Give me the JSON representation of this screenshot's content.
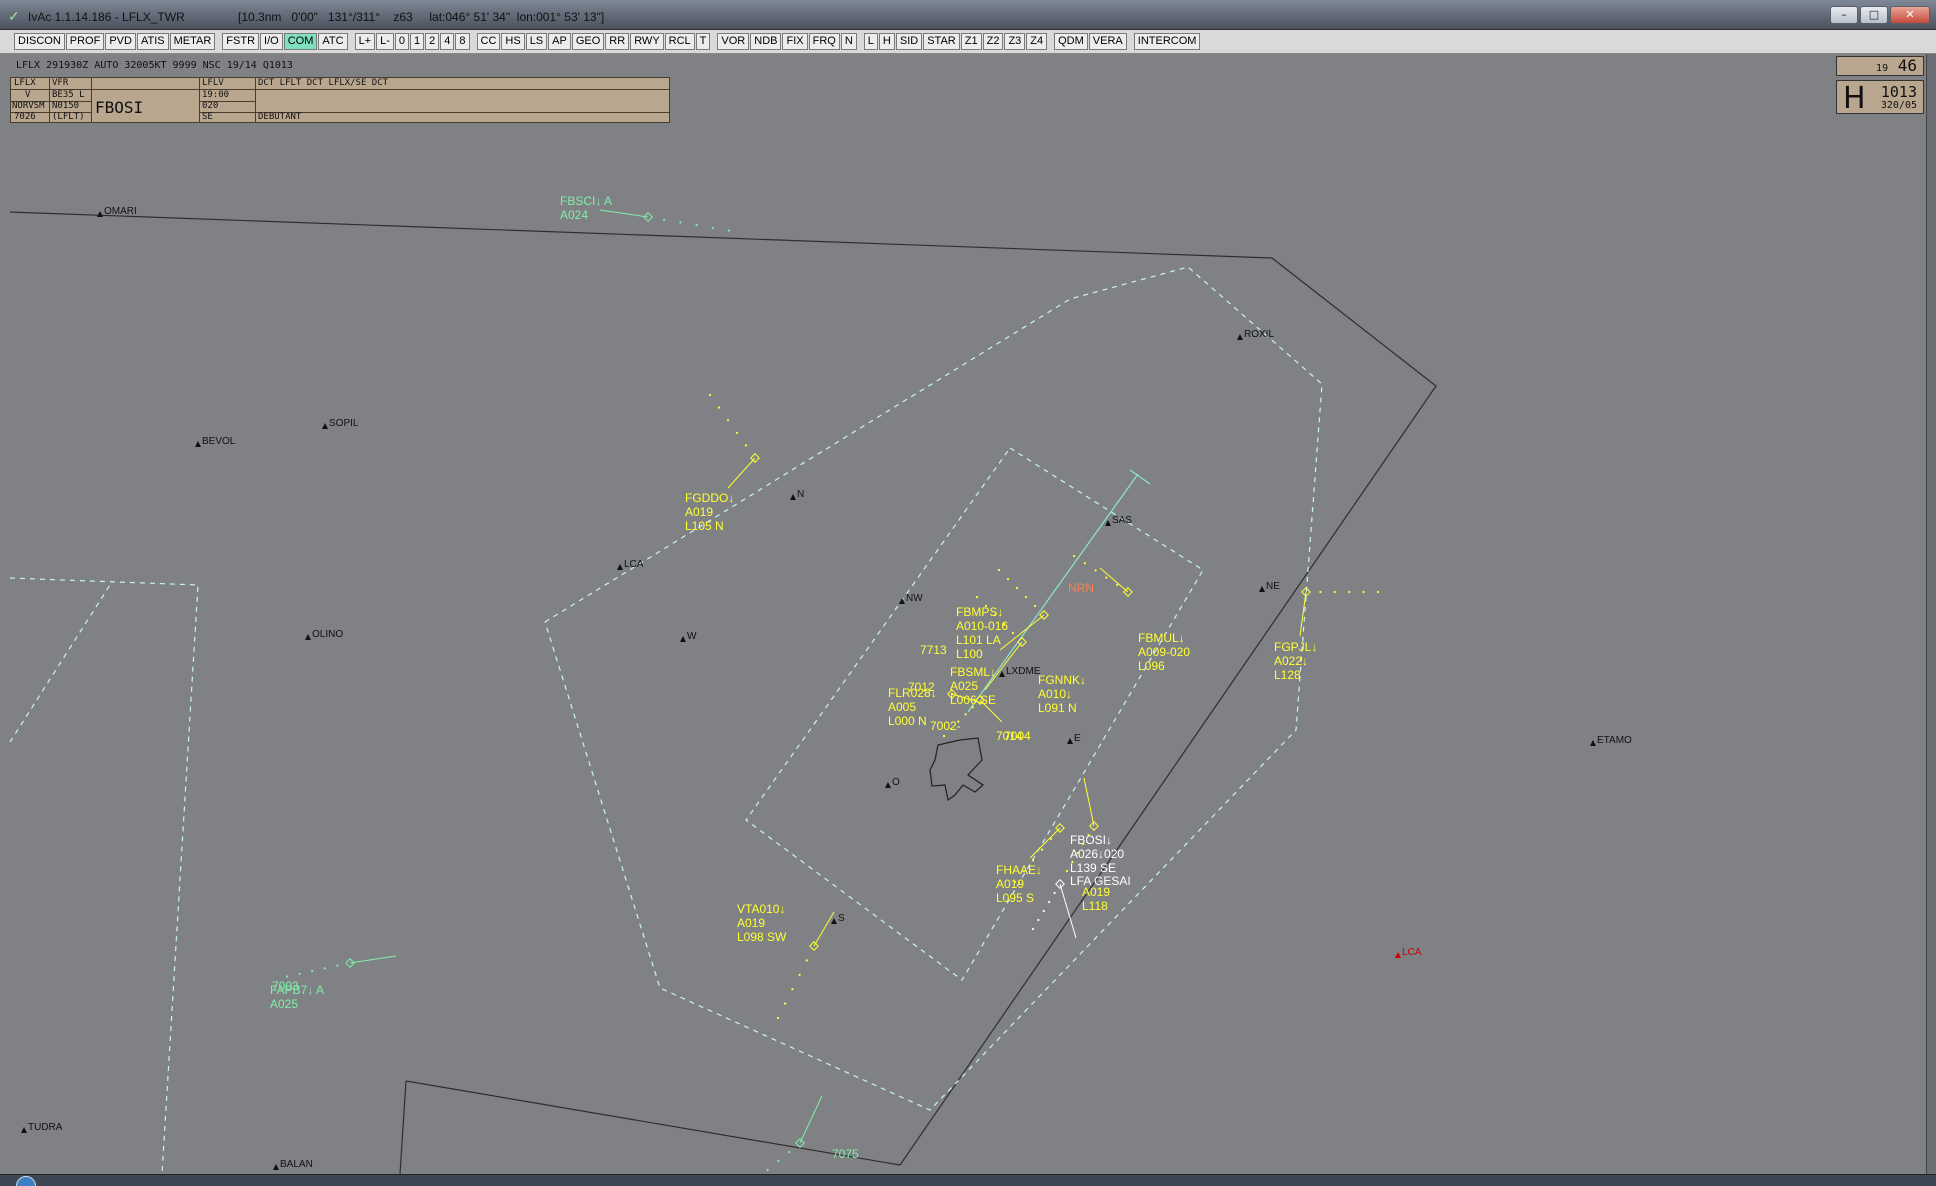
{
  "window": {
    "title": "IvAc 1.1.14.186 - LFLX_TWR",
    "status": "[10.3nm   0'00\"   131°/311°    z63     lat:046° 51' 34\"  lon:001° 53' 13\"]",
    "buttons": {
      "minimize": "–",
      "maximize": "□",
      "close": "✕"
    }
  },
  "toolbar": [
    {
      "label": "DISCON"
    },
    {
      "label": "PROF"
    },
    {
      "label": "PVD"
    },
    {
      "label": "ATIS"
    },
    {
      "label": "METAR"
    },
    {
      "label": "FSTR"
    },
    {
      "label": "I/O"
    },
    {
      "label": "COM",
      "active": true
    },
    {
      "label": "ATC"
    },
    {
      "label": "L+"
    },
    {
      "label": "L-"
    },
    {
      "label": "0"
    },
    {
      "label": "1"
    },
    {
      "label": "2"
    },
    {
      "label": "4"
    },
    {
      "label": "8"
    },
    {
      "label": "CC"
    },
    {
      "label": "HS"
    },
    {
      "label": "LS"
    },
    {
      "label": "AP"
    },
    {
      "label": "GEO"
    },
    {
      "label": "RR"
    },
    {
      "label": "RWY"
    },
    {
      "label": "RCL"
    },
    {
      "label": "T"
    },
    {
      "label": "VOR"
    },
    {
      "label": "NDB"
    },
    {
      "label": "FIX"
    },
    {
      "label": "FRQ"
    },
    {
      "label": "N"
    },
    {
      "label": "L"
    },
    {
      "label": "H"
    },
    {
      "label": "SID"
    },
    {
      "label": "STAR"
    },
    {
      "label": "Z1"
    },
    {
      "label": "Z2"
    },
    {
      "label": "Z3"
    },
    {
      "label": "Z4"
    },
    {
      "label": "QDM"
    },
    {
      "label": "VERA"
    },
    {
      "label": "INTERCOM"
    }
  ],
  "metar": "LFLX 291930Z AUTO 32005KT 9999 NSC 19/14 Q1013",
  "strip": {
    "dep": "LFLX",
    "rules": "VFR",
    "arr": "LFLV",
    "route": "DCT LFLT DCT LFLX/SE DCT",
    "v": "V",
    "type": "BE35 L",
    "time": "19:00",
    "norvsm": "NORVSM",
    "level": "N0150",
    "alt": "020",
    "squawk": "7026",
    "alt_ap": "(LFLT)",
    "callsign": "FBOSI",
    "exit": "SE",
    "remark": "DEBUTANT"
  },
  "clock": {
    "small": "19",
    "big": "46"
  },
  "qnh": {
    "letter": "H",
    "value": "1013",
    "wind": "320/05"
  },
  "colors": {
    "scope_bg": "#808185",
    "yellow": "#ffff33",
    "green": "#7ff0a8",
    "cyan": "#bff2f2",
    "white": "#ffffff",
    "red": "#cc0000",
    "boundary": "#2e2e2e"
  },
  "fixes": [
    {
      "name": "OMARI"
    },
    {
      "name": "ROXIL"
    },
    {
      "name": "SOPIL"
    },
    {
      "name": "BEVOL"
    },
    {
      "name": "N"
    },
    {
      "name": "SAS"
    },
    {
      "name": "LCA"
    },
    {
      "name": "NW"
    },
    {
      "name": "NE"
    },
    {
      "name": "OLINO"
    },
    {
      "name": "W"
    },
    {
      "name": "LXDME"
    },
    {
      "name": "E"
    },
    {
      "name": "ETAMO"
    },
    {
      "name": "S"
    },
    {
      "name": "LCA"
    },
    {
      "name": "TUDRA"
    },
    {
      "name": "BALAN"
    },
    {
      "name": "O"
    }
  ],
  "labels": {
    "fbsci": [
      "FBSCI↓ A",
      "A024"
    ],
    "fgddo": [
      "FGDDO↓",
      "A019",
      "L105 N"
    ],
    "fbmps": [
      "FBMPS↓",
      "A010-016",
      "L101 LA",
      "L100"
    ],
    "n7713": [
      "7713"
    ],
    "fbmul": [
      "FBMUL↓",
      "A009-020",
      "L096"
    ],
    "fgpjl": [
      "FGPJL↓",
      "A022↓",
      "L128"
    ],
    "fgnnk": [
      "FGNNK↓",
      "A010↓",
      "L091 N"
    ],
    "fbsml": [
      "FBSML↓",
      "A025",
      "L006 SE"
    ],
    "n7012": [
      "7012"
    ],
    "flr028": [
      "FLR028↓",
      "A005",
      "L000 N"
    ],
    "n7002": [
      "7002-"
    ],
    "n7014": [
      "7014"
    ],
    "n7004": [
      "7004"
    ],
    "fbosi": [
      "FBOSI↓",
      "A026↓020",
      "L139 SE"
    ],
    "fhaae": [
      "FHAAE↓",
      "A019",
      "L095 S"
    ],
    "lfa": [
      "LFA GESAI"
    ],
    "a019b": [
      "A019",
      "L118"
    ],
    "vta010": [
      "VTA010↓",
      "A019",
      "L098 SW"
    ],
    "fapb7": [
      "FAPB7↓ A",
      "A025"
    ],
    "n7003": [
      "7003"
    ],
    "n7075": [
      "7075"
    ],
    "nrwy": [
      "NRN"
    ]
  }
}
